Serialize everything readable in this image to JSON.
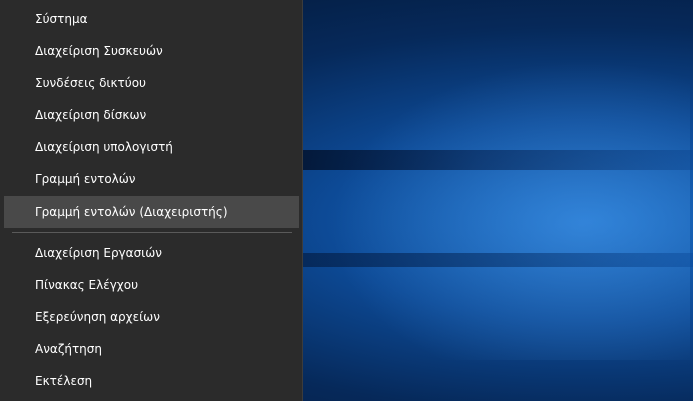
{
  "menu": {
    "items": [
      {
        "label": "Σύστημα"
      },
      {
        "label": "Διαχείριση Συσκευών"
      },
      {
        "label": "Συνδέσεις δικτύου"
      },
      {
        "label": "Διαχείριση δίσκων"
      },
      {
        "label": "Διαχείριση υπολογιστή"
      },
      {
        "label": "Γραμμή εντολών"
      },
      {
        "label": "Γραμμή εντολών (Διαχειριστής)"
      },
      {
        "label": "Διαχείριση Εργασιών"
      },
      {
        "label": "Πίνακας Ελέγχου"
      },
      {
        "label": "Εξερεύνηση αρχείων"
      },
      {
        "label": "Αναζήτηση"
      },
      {
        "label": "Εκτέλεση"
      }
    ],
    "selected_index": 6
  }
}
